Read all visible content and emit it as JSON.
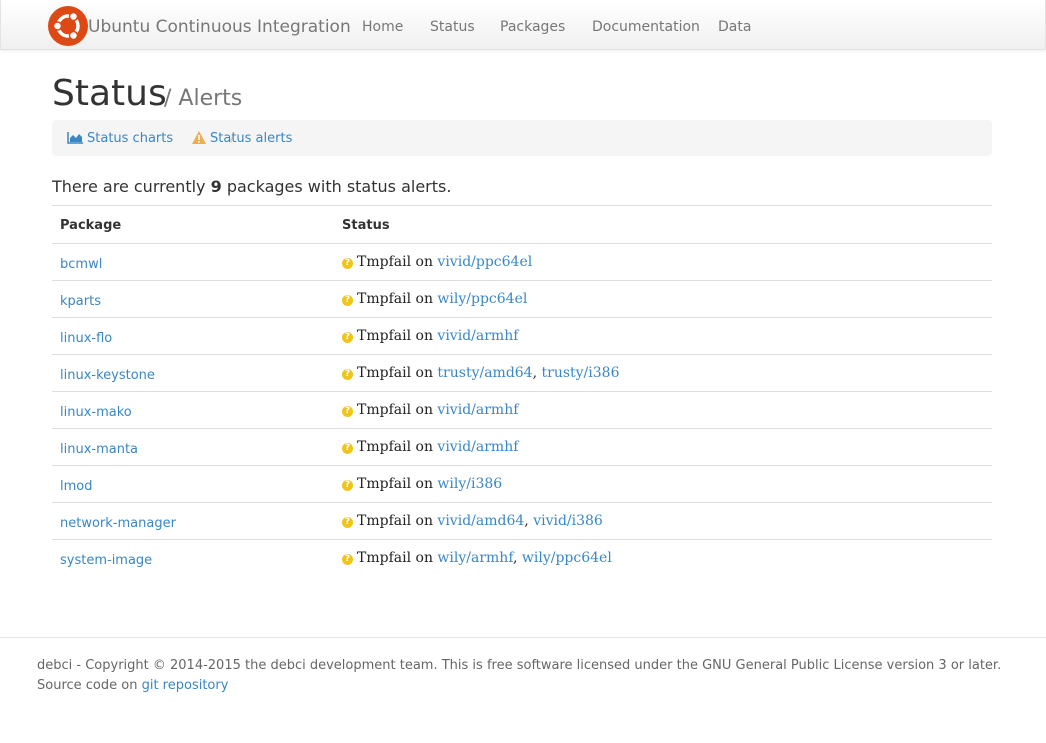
{
  "navbar": {
    "brand": "Ubuntu Continuous Integration",
    "items": [
      "Home",
      "Status",
      "Packages",
      "Documentation",
      "Data"
    ]
  },
  "header": {
    "title": "Status",
    "subtitle": "/ Alerts"
  },
  "breadcrumb": {
    "charts_label": "Status charts",
    "alerts_label": "Status alerts",
    "separator": "/"
  },
  "summary": {
    "prefix": "There are currently ",
    "count": "9",
    "suffix": " packages with status alerts."
  },
  "table": {
    "headers": [
      "Package",
      "Status"
    ],
    "status_prefix": "Tmpfail on",
    "rows": [
      {
        "package": "bcmwl",
        "targets": [
          "vivid/ppc64el"
        ]
      },
      {
        "package": "kparts",
        "targets": [
          "wily/ppc64el"
        ]
      },
      {
        "package": "linux-flo",
        "targets": [
          "vivid/armhf"
        ]
      },
      {
        "package": "linux-keystone",
        "targets": [
          "trusty/amd64",
          "trusty/i386"
        ]
      },
      {
        "package": "linux-mako",
        "targets": [
          "vivid/armhf"
        ]
      },
      {
        "package": "linux-manta",
        "targets": [
          "vivid/armhf"
        ]
      },
      {
        "package": "lmod",
        "targets": [
          "wily/i386"
        ]
      },
      {
        "package": "network-manager",
        "targets": [
          "vivid/amd64",
          "vivid/i386"
        ]
      },
      {
        "package": "system-image",
        "targets": [
          "wily/armhf",
          "wily/ppc64el"
        ]
      }
    ]
  },
  "footer": {
    "line1": "debci - Copyright © 2014-2015 the debci development team. This is free software licensed under the GNU General Public License version 3 or later.",
    "line2_prefix": "Source code on ",
    "link": "git repository"
  },
  "colors": {
    "accent": "#3a87c4",
    "ubuntu_orange": "#dd4814",
    "warning": "#f0ad4e",
    "tmpfail_icon": "#f0c419"
  },
  "icons": {
    "logo": "ubuntu-logo-icon",
    "charts": "area-chart-icon",
    "alerts": "warning-icon",
    "status": "question-circle-icon"
  }
}
